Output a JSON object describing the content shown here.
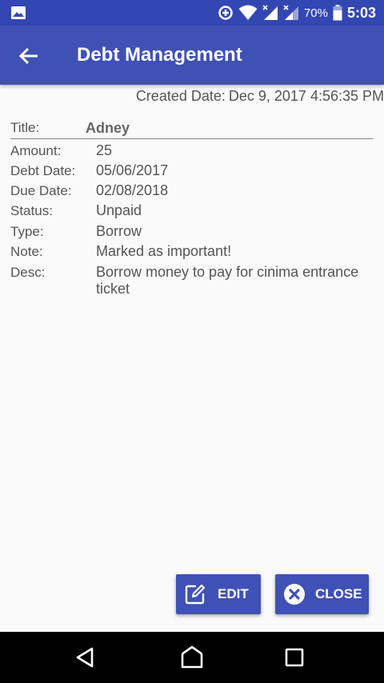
{
  "status_bar": {
    "battery": "70%",
    "time": "5:03"
  },
  "app_bar": {
    "title": "Debt Management"
  },
  "record": {
    "created_label": "Created Date:",
    "created_value": "Dec 9, 2017 4:56:35 PM",
    "title_label": "Title:",
    "title_value": "Adney",
    "fields": [
      {
        "label": "Amount:",
        "value": "25"
      },
      {
        "label": "Debt Date:",
        "value": "05/06/2017"
      },
      {
        "label": "Due Date:",
        "value": "02/08/2018"
      },
      {
        "label": "Status:",
        "value": "Unpaid"
      },
      {
        "label": "Type:",
        "value": "Borrow"
      },
      {
        "label": "Note:",
        "value": "Marked as important!"
      },
      {
        "label": "Desc:",
        "value": "Borrow money to pay for cinima entrance ticket"
      }
    ]
  },
  "actions": {
    "edit_label": "EDIT",
    "close_label": "CLOSE"
  },
  "colors": {
    "primary": "#3f51b5",
    "primary_dark": "#3347b3",
    "background": "#fafafa"
  }
}
